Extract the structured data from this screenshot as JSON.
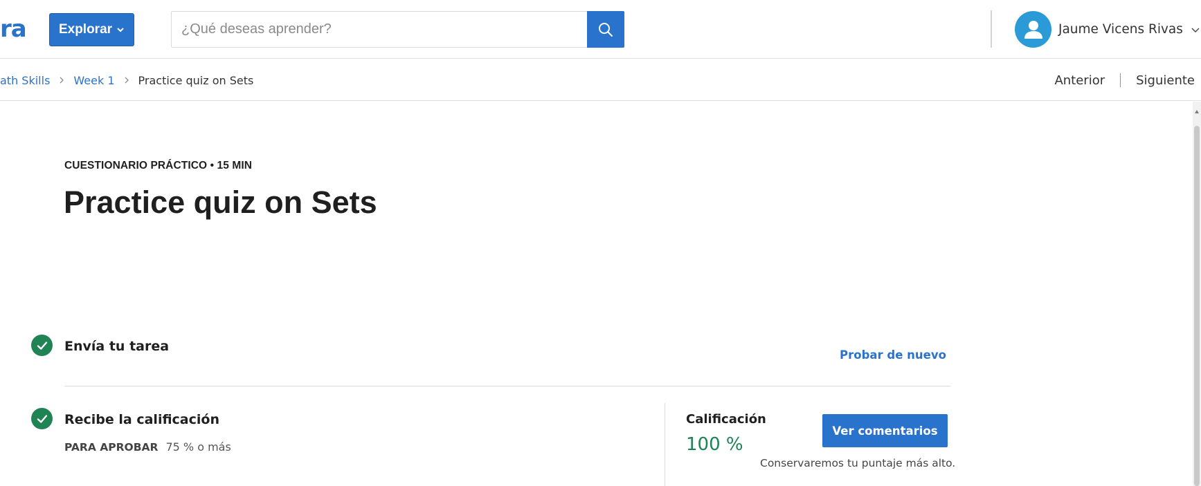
{
  "header": {
    "logo_text": "ra",
    "explore_label": "Explorar",
    "search_placeholder": "¿Qué deseas aprender?",
    "user_name": "Jaume Vicens Rivas"
  },
  "breadcrumb": {
    "items": [
      "ath Skills",
      "Week 1"
    ],
    "current": "Practice quiz on Sets"
  },
  "pager": {
    "prev_label": "Anterior",
    "next_label": "Siguiente"
  },
  "quiz": {
    "kicker": "CUESTIONARIO PRÁCTICO • 15 MIN",
    "title": "Practice quiz on Sets",
    "submit_step": {
      "title": "Envía tu tarea",
      "retry_label": "Probar de nuevo"
    },
    "grade_step": {
      "title": "Recibe la calificación",
      "pass_label": "PARA APROBAR",
      "pass_value": "75 % o más",
      "grade_label": "Calificación",
      "grade_value": "100 %",
      "feedback_label": "Ver comentarios",
      "note": "Conservaremos tu puntaje más alto."
    }
  },
  "colors": {
    "primary": "#2a73cc",
    "success": "#1f8354",
    "avatar": "#2a9bd6"
  }
}
